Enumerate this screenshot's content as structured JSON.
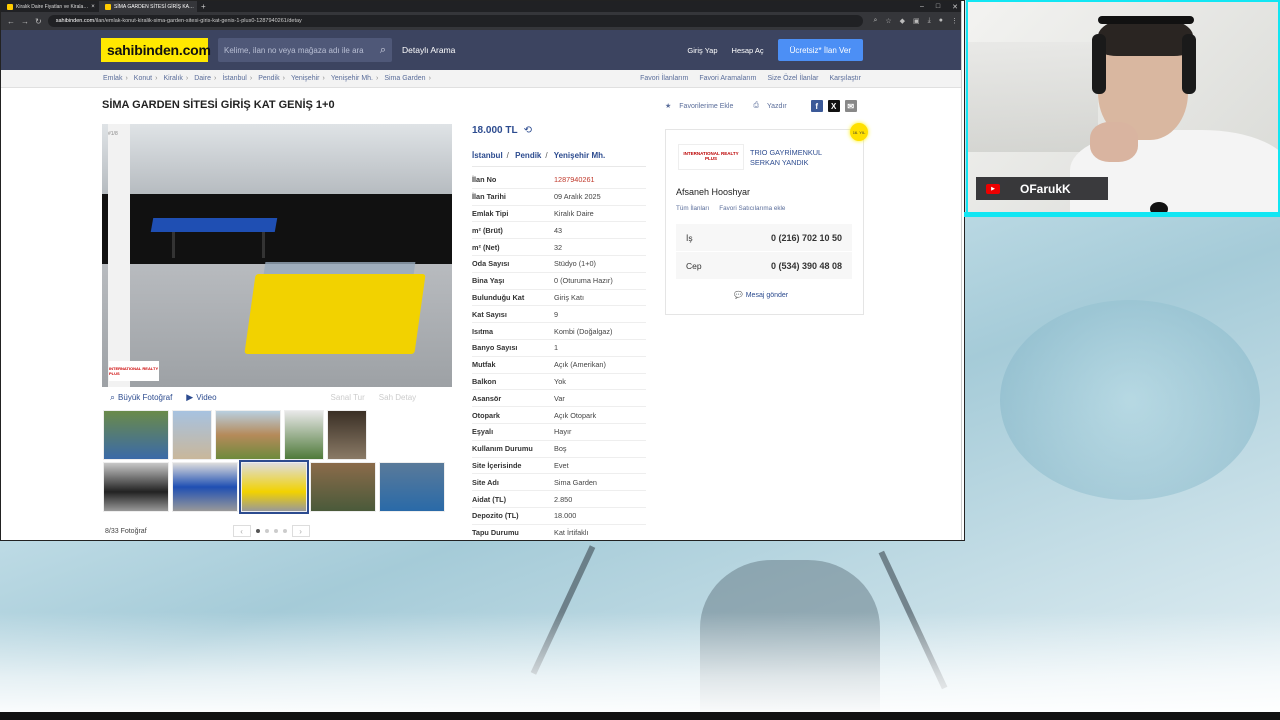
{
  "browser": {
    "tabs": [
      {
        "label": "Kiralık Daire Fiyatları ve Kirala…"
      },
      {
        "label": "SİMA GARDEN SİTESİ GİRİŞ KA…"
      }
    ],
    "url_domain": "sahibinden.com",
    "url_path": "/ilan/emlak-konut-kiralik-sima-garden-sitesi-giris-kat-genis-1-plus0-1287940261/detay"
  },
  "header": {
    "logo": "sahibinden.com",
    "search_placeholder": "Kelime, ilan no veya mağaza adı ile ara",
    "advanced_search": "Detaylı Arama",
    "login": "Giriş Yap",
    "register": "Hesap Aç",
    "cta": "Ücretsiz* İlan Ver"
  },
  "breadcrumb": {
    "items": [
      "Emlak",
      "Konut",
      "Kiralık",
      "Daire",
      "İstanbul",
      "Pendik",
      "Yenişehir",
      "Yenişehir Mh.",
      "Sima Garden"
    ],
    "links": [
      "Favori İlanlarım",
      "Favori Aramalarım",
      "Size Özel İlanlar",
      "Karşılaştır"
    ]
  },
  "listing": {
    "title": "SİMA GARDEN SİTESİ GİRİŞ KAT GENİŞ 1+0",
    "add_favorite": "Favorilerime Ekle",
    "print": "Yazdır",
    "price": "18.000 TL",
    "location": {
      "city": "İstanbul",
      "district": "Pendik",
      "neighborhood": "Yenişehir Mh."
    },
    "photo_counter": "8/33 Fotoğraf",
    "photo_index": "#1/8",
    "photo_watermark": "INTERNATIONAL REALTY PLUS",
    "photo_actions": {
      "large": "Büyük Fotoğraf",
      "video": "Video",
      "virtual_tour": "Sanal Tur",
      "floor_plan": "Sah Detay"
    },
    "properties": [
      {
        "k": "İlan No",
        "v": "1287940261"
      },
      {
        "k": "İlan Tarihi",
        "v": "09 Aralık 2025"
      },
      {
        "k": "Emlak Tipi",
        "v": "Kiralık Daire"
      },
      {
        "k": "m² (Brüt)",
        "v": "43"
      },
      {
        "k": "m² (Net)",
        "v": "32"
      },
      {
        "k": "Oda Sayısı",
        "v": "Stüdyo (1+0)"
      },
      {
        "k": "Bina Yaşı",
        "v": "0 (Oturuma Hazır)"
      },
      {
        "k": "Bulunduğu Kat",
        "v": "Giriş Katı"
      },
      {
        "k": "Kat Sayısı",
        "v": "9"
      },
      {
        "k": "Isıtma",
        "v": "Kombi (Doğalgaz)"
      },
      {
        "k": "Banyo Sayısı",
        "v": "1"
      },
      {
        "k": "Mutfak",
        "v": "Açık (Amerikan)"
      },
      {
        "k": "Balkon",
        "v": "Yok"
      },
      {
        "k": "Asansör",
        "v": "Var"
      },
      {
        "k": "Otopark",
        "v": "Açık Otopark"
      },
      {
        "k": "Eşyalı",
        "v": "Hayır"
      },
      {
        "k": "Kullanım Durumu",
        "v": "Boş"
      },
      {
        "k": "Site İçerisinde",
        "v": "Evet"
      },
      {
        "k": "Site Adı",
        "v": "Sima Garden"
      },
      {
        "k": "Aidat (TL)",
        "v": "2.850"
      },
      {
        "k": "Depozito (TL)",
        "v": "18.000"
      },
      {
        "k": "Tapu Durumu",
        "v": "Kat İrtifaklı"
      }
    ]
  },
  "agent": {
    "badge": "16. YIL",
    "logo_text": "INTERNATIONAL REALTY PLUS",
    "company": "TRIO GAYRİMENKUL SERKAN YANDIK",
    "person": "Afsaneh Hooshyar",
    "all_listings": "Tüm İlanları",
    "fav_seller": "Favori Satıcılarıma ekle",
    "phones": [
      {
        "label": "İş",
        "number": "0 (216) 702 10 50"
      },
      {
        "label": "Cep",
        "number": "0 (534) 390 48 08"
      }
    ],
    "message": "Mesaj gönder"
  },
  "stream": {
    "name": "OFarukK"
  },
  "colors": {
    "accent": "#2c4b8f",
    "header": "#3c4460",
    "logo": "#ffe800",
    "cta": "#4c8ff5",
    "cam_border": "#11e6f3"
  }
}
